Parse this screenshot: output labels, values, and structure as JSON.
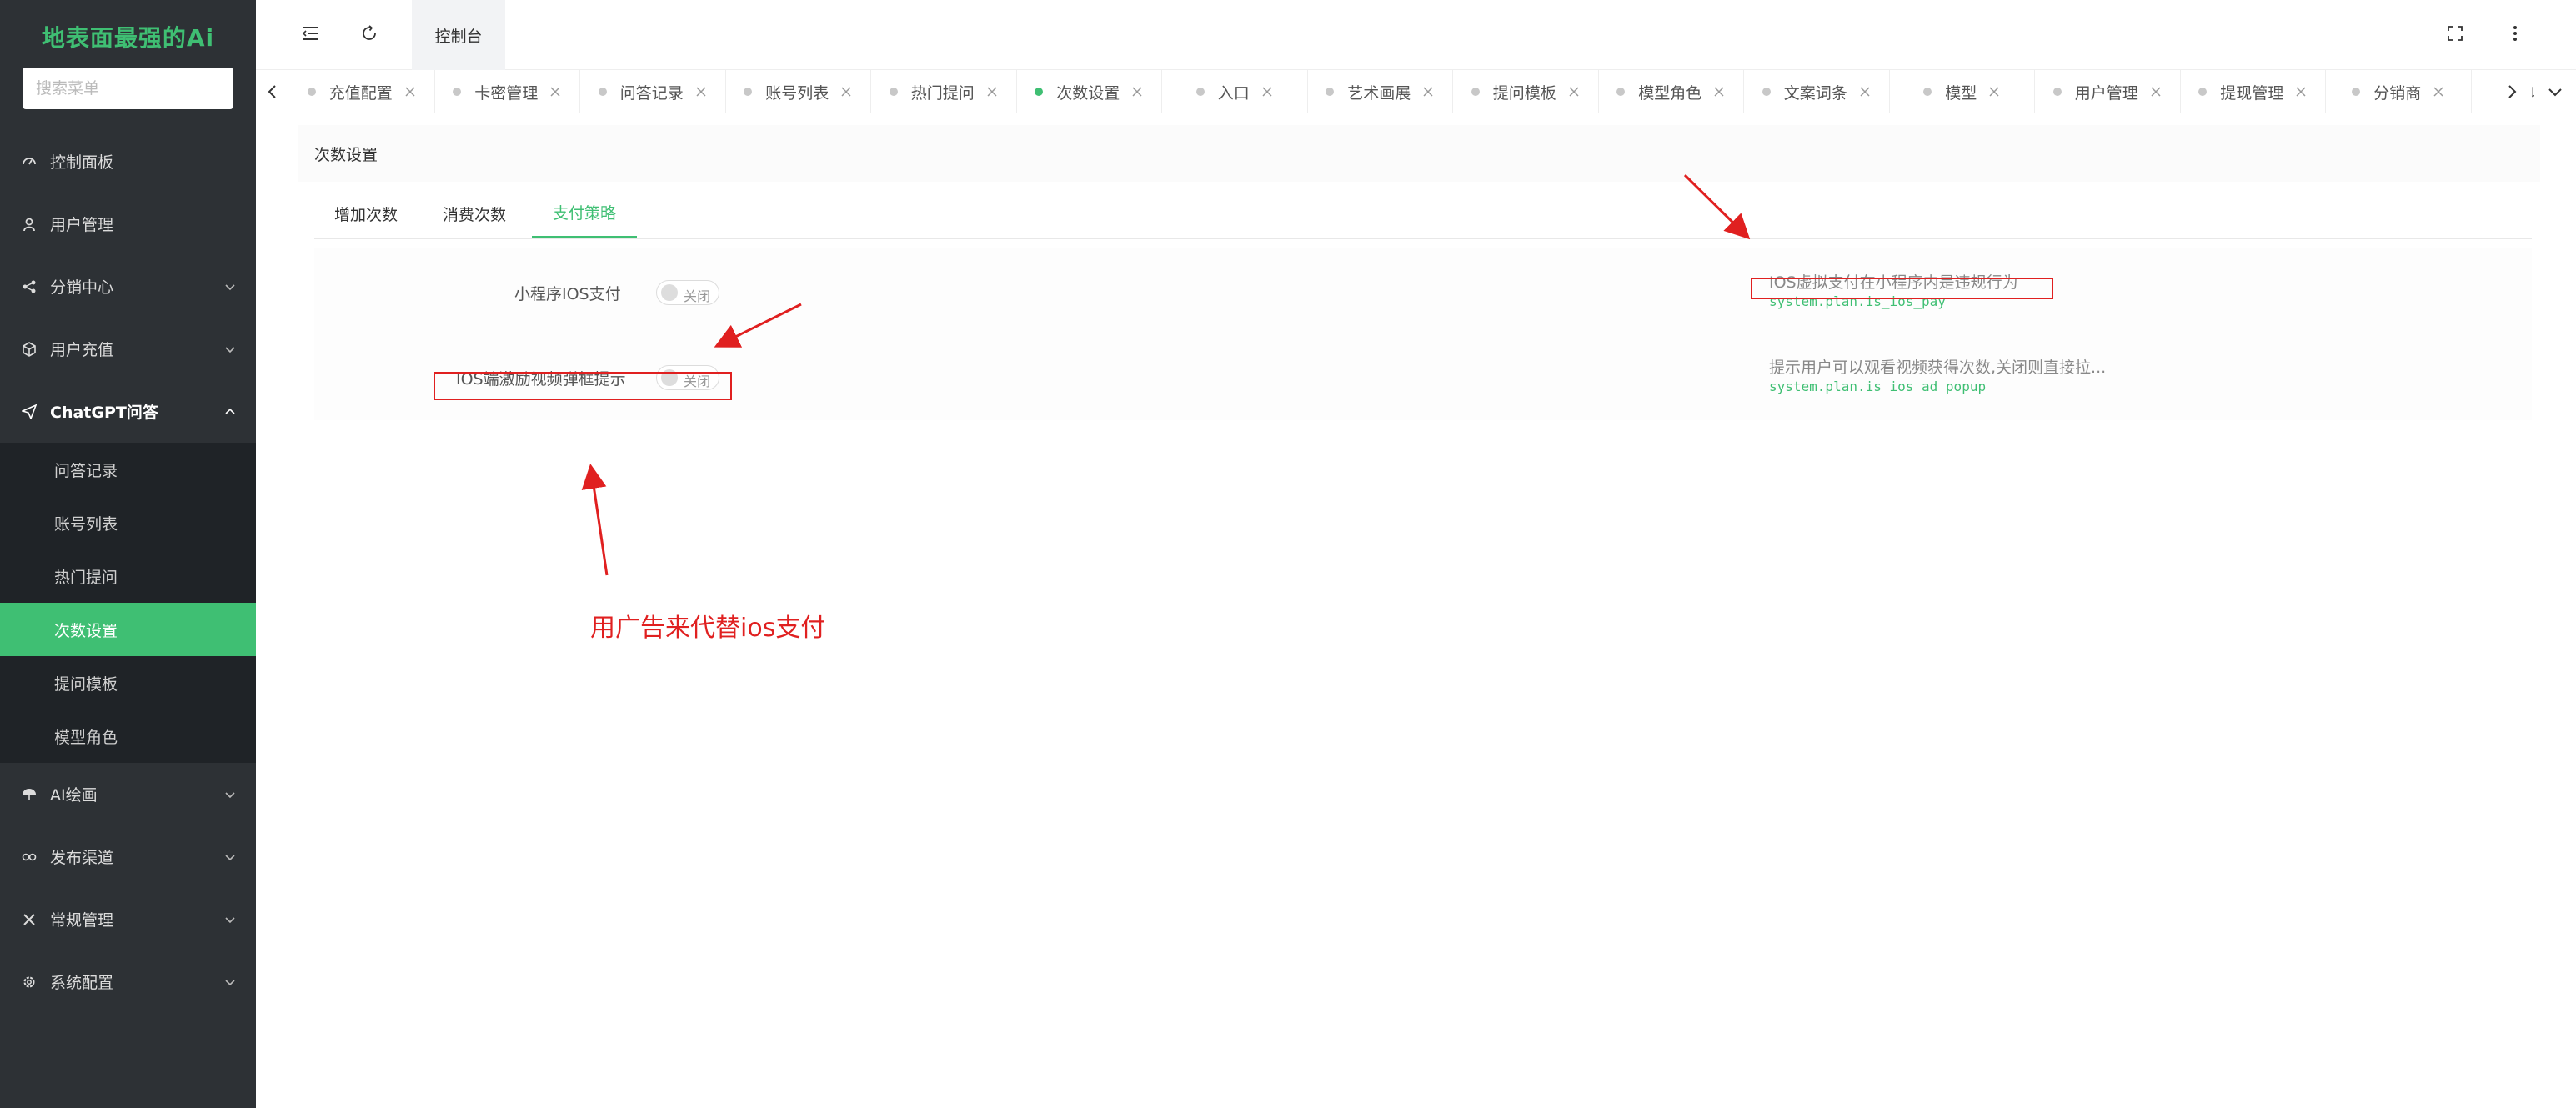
{
  "sidebar": {
    "logo": "地表面最强的Ai",
    "search_placeholder": "搜索菜单",
    "items": [
      {
        "label": "控制面板",
        "icon": "dashboard-icon"
      },
      {
        "label": "用户管理",
        "icon": "user-icon"
      },
      {
        "label": "分销中心",
        "icon": "share-icon",
        "expandable": true
      },
      {
        "label": "用户充值",
        "icon": "box-icon",
        "expandable": true
      },
      {
        "label": "ChatGPT问答",
        "icon": "send-icon",
        "expandable": true,
        "open": true
      },
      {
        "label": "AI绘画",
        "icon": "umbrella-icon",
        "expandable": true
      },
      {
        "label": "发布渠道",
        "icon": "link-icon",
        "expandable": true
      },
      {
        "label": "常规管理",
        "icon": "tools-icon",
        "expandable": true
      },
      {
        "label": "系统配置",
        "icon": "gear-icon",
        "expandable": true
      }
    ],
    "subitems": [
      "问答记录",
      "账号列表",
      "热门提问",
      "次数设置",
      "提问模板",
      "模型角色"
    ],
    "active_subitem": "次数设置"
  },
  "topbar": {
    "home_tab": "控制台"
  },
  "tabs": [
    "充值配置",
    "卡密管理",
    "问答记录",
    "账号列表",
    "热门提问",
    "次数设置",
    "入口",
    "艺术画展",
    "提问模板",
    "模型角色",
    "文案词条",
    "模型",
    "用户管理",
    "提现管理",
    "分销商",
    "收入记"
  ],
  "active_tab": "次数设置",
  "card": {
    "title": "次数设置",
    "subtabs": [
      "增加次数",
      "消费次数",
      "支付策略"
    ],
    "active_subtab": "支付策略"
  },
  "form": {
    "rows": [
      {
        "label": "小程序IOS支付",
        "toggle_text": "关闭",
        "description": "IOS虚拟支付在小程序内是违规行为",
        "key": "system.plan.is_ios_pay"
      },
      {
        "label": "IOS端激励视频弹框提示",
        "toggle_text": "关闭",
        "description": "提示用户可以观看视频获得次数,关闭则直接拉...",
        "key": "system.plan.is_ios_ad_popup"
      }
    ]
  },
  "annotation": {
    "text": "用广告来代替ios支付",
    "color": "#e02020"
  },
  "colors": {
    "accent": "#3fbf73",
    "sidebar_bg": "#2d3135",
    "annotation": "#e02020"
  }
}
